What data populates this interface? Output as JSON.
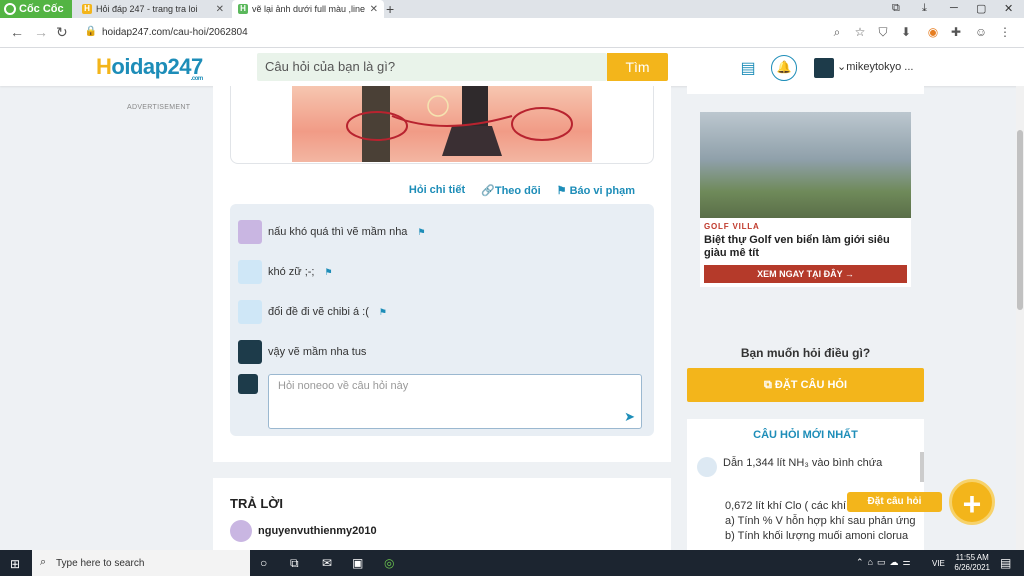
{
  "browser": {
    "brand": "Cốc Cốc",
    "tabs": [
      {
        "title": "Hỏi đáp 247 - trang tra loi",
        "icon": "H"
      },
      {
        "title": "vẽ lại ảnh dưới full màu ,line",
        "icon": "H"
      }
    ],
    "url": "hoidap247.com/cau-hoi/2062804"
  },
  "header": {
    "logo": "oidap247",
    "logo_first": "H",
    "logo_sub": ".com",
    "search_placeholder": "Câu hỏi của bạn là gì?",
    "search_button": "Tìm",
    "username": "mikeytokyo ..."
  },
  "sidebar": {
    "ad_label": "ADVERTISEMENT"
  },
  "question_actions": {
    "detail": "Hỏi chi tiết",
    "follow": "Theo dõi",
    "report": "Báo vi phạm"
  },
  "comments": [
    {
      "text": "nấu khó quá thì vẽ mầm nha"
    },
    {
      "text": "khó zữ ;-;"
    },
    {
      "text": "đổi đề đi vẽ chibi á :("
    },
    {
      "text": "vậy vẽ mầm nha tus"
    }
  ],
  "reply_placeholder": "Hỏi noneoo về câu hỏi này",
  "answers": {
    "title": "TRẢ LỜI",
    "first_user": "nguyenvuthienmy2010"
  },
  "ad": {
    "tag": "GOLF VILLA",
    "headline": "Biệt thự Golf ven biển làm giới siêu giàu mê tít",
    "cta": "XEM NGAY TẠI ĐÂY →"
  },
  "ask": {
    "question": "Bạn muốn hỏi điều gì?",
    "button": "ĐẶT CÂU HỎI"
  },
  "newest": {
    "title": "CÂU HỎI MỚI NHẤT",
    "first_line": "Dẫn 1,344 lít  NH₃ vào bình chứa",
    "body_lines": [
      "0,672 lít khí Clo ( các khí đ...",
      "a) Tính % V hỗn hợp khí sau phản ứng",
      "b) Tính khối lượng muối amoni clorua"
    ]
  },
  "floating": {
    "label": "Đặt câu hỏi",
    "icon": "+"
  },
  "taskbar": {
    "search": "Type here to search",
    "time": "11:55 AM",
    "date": "6/26/2021",
    "lang": "VIE"
  }
}
